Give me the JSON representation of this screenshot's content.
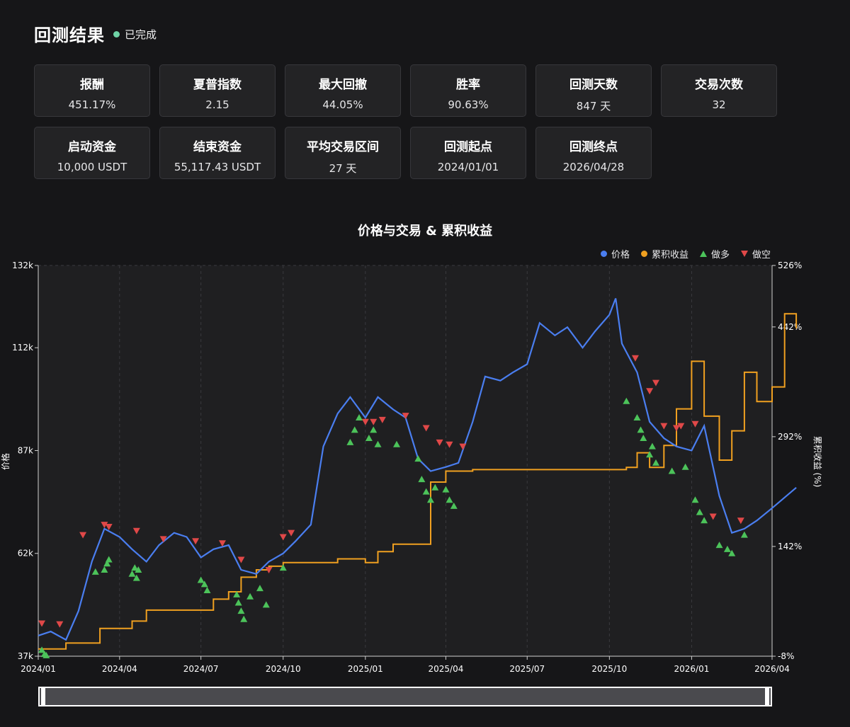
{
  "header": {
    "title": "回测结果",
    "status": "已完成",
    "status_color": "#6fd3a6"
  },
  "stats": [
    {
      "label": "报酬",
      "value": "451.17%"
    },
    {
      "label": "夏普指数",
      "value": "2.15"
    },
    {
      "label": "最大回撤",
      "value": "44.05%"
    },
    {
      "label": "胜率",
      "value": "90.63%"
    },
    {
      "label": "回测天数",
      "value": "847 天"
    },
    {
      "label": "交易次数",
      "value": "32"
    },
    {
      "label": "启动资金",
      "value": "10,000 USDT"
    },
    {
      "label": "结束资金",
      "value": "55,117.43 USDT"
    },
    {
      "label": "平均交易区间",
      "value": "27 天"
    },
    {
      "label": "回测起点",
      "value": "2024/01/01"
    },
    {
      "label": "回测终点",
      "value": "2026/04/28"
    }
  ],
  "chart_data": {
    "type": "line",
    "title": "价格与交易 & 累积收益",
    "legend_position": "top-right",
    "legend": [
      "价格",
      "累积收益",
      "做多",
      "做空"
    ],
    "colors": {
      "price": "#4a7ef0",
      "return": "#f0a020",
      "long": "#4cc35a",
      "short": "#e04848"
    },
    "ylabel_left": "价格",
    "ylabel_right": "累积收益 (%)",
    "y_left_ticks": [
      "132k",
      "112k",
      "87k",
      "62k",
      "37k"
    ],
    "y_left_range": [
      37000,
      132000
    ],
    "y_right_ticks": [
      "526%",
      "442%",
      "292%",
      "142%",
      "-8%"
    ],
    "y_right_range": [
      -8,
      526
    ],
    "x_ticks": [
      "2024/01",
      "2024/04",
      "2024/07",
      "2024/10",
      "2025/01",
      "2025/04",
      "2025/07",
      "2025/10",
      "2026/01",
      "2026/04"
    ],
    "grid": "vertical-dashed",
    "series": [
      {
        "name": "价格",
        "x": [
          "2024-01-01",
          "2024-01-15",
          "2024-02-01",
          "2024-02-15",
          "2024-03-01",
          "2024-03-15",
          "2024-04-01",
          "2024-04-15",
          "2024-05-01",
          "2024-05-15",
          "2024-06-01",
          "2024-06-15",
          "2024-07-01",
          "2024-07-15",
          "2024-08-01",
          "2024-08-15",
          "2024-09-01",
          "2024-09-15",
          "2024-10-01",
          "2024-10-15",
          "2024-11-01",
          "2024-11-15",
          "2024-12-01",
          "2024-12-15",
          "2025-01-01",
          "2025-01-15",
          "2025-02-01",
          "2025-02-15",
          "2025-03-01",
          "2025-03-15",
          "2025-04-01",
          "2025-04-15",
          "2025-05-01",
          "2025-05-15",
          "2025-06-01",
          "2025-06-15",
          "2025-07-01",
          "2025-07-15",
          "2025-08-01",
          "2025-08-15",
          "2025-09-01",
          "2025-09-15",
          "2025-10-01",
          "2025-10-08",
          "2025-10-15",
          "2025-11-01",
          "2025-11-15",
          "2025-12-01",
          "2025-12-15",
          "2026-01-01",
          "2026-01-15",
          "2026-02-01",
          "2026-02-15",
          "2026-03-01",
          "2026-03-15",
          "2026-04-01",
          "2026-04-28"
        ],
        "y": [
          42000,
          43000,
          41000,
          48000,
          60000,
          68000,
          66000,
          63000,
          60000,
          64000,
          67000,
          66000,
          61000,
          63000,
          64000,
          58000,
          57000,
          60000,
          62000,
          65000,
          69000,
          88000,
          96000,
          100000,
          95000,
          100000,
          97000,
          95000,
          85000,
          82000,
          83000,
          84000,
          94000,
          105000,
          104000,
          106000,
          108000,
          118000,
          115000,
          117000,
          112000,
          116000,
          120000,
          124000,
          113000,
          106000,
          94000,
          90000,
          88000,
          87000,
          93000,
          76000,
          67000,
          68000,
          70000,
          73000,
          78000
        ]
      },
      {
        "name": "累积收益",
        "x": [
          "2024-01-01",
          "2024-01-10",
          "2024-02-01",
          "2024-03-01",
          "2024-03-10",
          "2024-04-01",
          "2024-04-15",
          "2024-05-01",
          "2024-06-01",
          "2024-07-01",
          "2024-07-15",
          "2024-08-01",
          "2024-08-15",
          "2024-09-01",
          "2024-09-15",
          "2024-10-01",
          "2024-11-01",
          "2024-12-01",
          "2024-12-20",
          "2025-01-01",
          "2025-01-15",
          "2025-02-01",
          "2025-03-01",
          "2025-03-15",
          "2025-04-01",
          "2025-04-15",
          "2025-05-01",
          "2025-06-01",
          "2025-07-01",
          "2025-08-01",
          "2025-09-01",
          "2025-10-01",
          "2025-10-20",
          "2025-11-01",
          "2025-11-15",
          "2025-12-01",
          "2025-12-15",
          "2026-01-01",
          "2026-01-15",
          "2026-02-01",
          "2026-02-15",
          "2026-03-01",
          "2026-03-15",
          "2026-04-01",
          "2026-04-15",
          "2026-04-28"
        ],
        "y": [
          2,
          2,
          10,
          10,
          30,
          30,
          40,
          55,
          55,
          55,
          70,
          80,
          100,
          110,
          115,
          120,
          120,
          125,
          125,
          120,
          135,
          145,
          145,
          230,
          245,
          245,
          247,
          247,
          247,
          247,
          247,
          247,
          250,
          270,
          250,
          280,
          330,
          395,
          320,
          260,
          300,
          380,
          340,
          360,
          460,
          440
        ]
      }
    ],
    "markers": {
      "long": [
        [
          "2024-01-05",
          38500
        ],
        [
          "2024-01-08",
          37500
        ],
        [
          "2024-01-10",
          37200
        ],
        [
          "2024-03-05",
          57500
        ],
        [
          "2024-03-15",
          58000
        ],
        [
          "2024-03-18",
          59500
        ],
        [
          "2024-03-20",
          60500
        ],
        [
          "2024-04-15",
          57000
        ],
        [
          "2024-04-18",
          58500
        ],
        [
          "2024-04-20",
          56000
        ],
        [
          "2024-04-22",
          58000
        ],
        [
          "2024-07-01",
          55500
        ],
        [
          "2024-07-05",
          54500
        ],
        [
          "2024-07-08",
          53000
        ],
        [
          "2024-08-10",
          52000
        ],
        [
          "2024-08-12",
          50000
        ],
        [
          "2024-08-15",
          48000
        ],
        [
          "2024-08-18",
          46000
        ],
        [
          "2024-08-25",
          51500
        ],
        [
          "2024-09-05",
          53500
        ],
        [
          "2024-09-12",
          49500
        ],
        [
          "2024-10-01",
          58500
        ],
        [
          "2024-12-15",
          89000
        ],
        [
          "2024-12-20",
          92000
        ],
        [
          "2024-12-25",
          95000
        ],
        [
          "2025-01-05",
          90000
        ],
        [
          "2025-01-10",
          92000
        ],
        [
          "2025-01-15",
          88500
        ],
        [
          "2025-02-05",
          88500
        ],
        [
          "2025-03-01",
          85000
        ],
        [
          "2025-03-05",
          80000
        ],
        [
          "2025-03-10",
          77000
        ],
        [
          "2025-03-15",
          75000
        ],
        [
          "2025-03-20",
          78000
        ],
        [
          "2025-04-01",
          77500
        ],
        [
          "2025-04-05",
          75000
        ],
        [
          "2025-04-10",
          73500
        ],
        [
          "2025-10-20",
          99000
        ],
        [
          "2025-11-01",
          95000
        ],
        [
          "2025-11-05",
          92000
        ],
        [
          "2025-11-08",
          90000
        ],
        [
          "2025-11-15",
          86000
        ],
        [
          "2025-11-18",
          88000
        ],
        [
          "2025-11-22",
          84000
        ],
        [
          "2025-12-10",
          82000
        ],
        [
          "2025-12-25",
          83000
        ],
        [
          "2026-01-05",
          75000
        ],
        [
          "2026-01-10",
          72000
        ],
        [
          "2026-01-15",
          70000
        ],
        [
          "2026-02-01",
          64000
        ],
        [
          "2026-02-10",
          63000
        ],
        [
          "2026-02-15",
          62000
        ],
        [
          "2026-03-01",
          66500
        ]
      ],
      "short": [
        [
          "2024-01-05",
          45000
        ],
        [
          "2024-01-25",
          44800
        ],
        [
          "2024-02-20",
          66500
        ],
        [
          "2024-03-15",
          69000
        ],
        [
          "2024-03-20",
          68500
        ],
        [
          "2024-04-20",
          67500
        ],
        [
          "2024-05-20",
          65500
        ],
        [
          "2024-06-25",
          65000
        ],
        [
          "2024-07-25",
          64500
        ],
        [
          "2024-08-15",
          60500
        ],
        [
          "2024-09-15",
          58000
        ],
        [
          "2024-10-01",
          66000
        ],
        [
          "2024-10-10",
          67000
        ],
        [
          "2025-01-01",
          94000
        ],
        [
          "2025-01-10",
          94000
        ],
        [
          "2025-01-20",
          94500
        ],
        [
          "2025-02-15",
          95500
        ],
        [
          "2025-03-10",
          92500
        ],
        [
          "2025-03-25",
          89000
        ],
        [
          "2025-04-05",
          88500
        ],
        [
          "2025-04-20",
          88000
        ],
        [
          "2025-10-30",
          109500
        ],
        [
          "2025-11-15",
          101500
        ],
        [
          "2025-11-22",
          103500
        ],
        [
          "2025-12-01",
          93000
        ],
        [
          "2025-12-15",
          92500
        ],
        [
          "2025-12-20",
          93000
        ],
        [
          "2026-01-05",
          93500
        ],
        [
          "2026-01-25",
          71000
        ],
        [
          "2026-02-25",
          70000
        ]
      ]
    }
  }
}
